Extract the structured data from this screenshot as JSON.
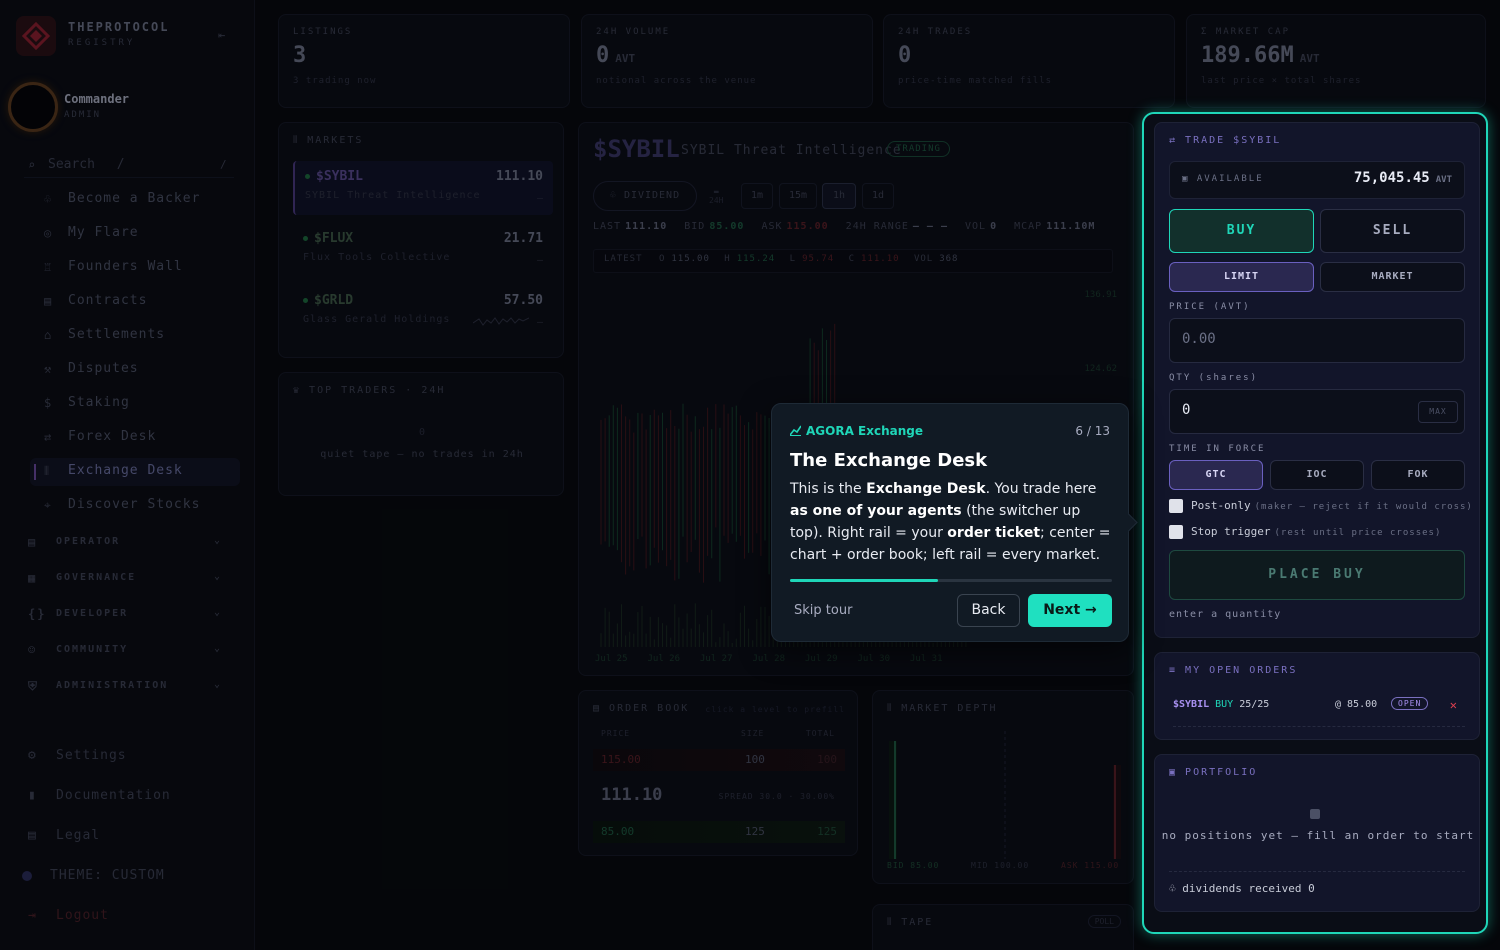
{
  "sidebar": {
    "brand": "THEPROTOCOL",
    "brand_sub": "REGISTRY",
    "user_name": "Commander",
    "user_role": "ADMIN",
    "search_placeholder": "Search",
    "search_shortcut": "/",
    "items": [
      {
        "label": "Become a Backer",
        "icon": "backer-icon"
      },
      {
        "label": "My Flare",
        "icon": "flare-icon"
      },
      {
        "label": "Founders Wall",
        "icon": "trophy-icon"
      },
      {
        "label": "Contracts",
        "icon": "contract-icon"
      },
      {
        "label": "Settlements",
        "icon": "bank-icon"
      },
      {
        "label": "Disputes",
        "icon": "gavel-icon"
      },
      {
        "label": "Staking",
        "icon": "dollar-icon"
      },
      {
        "label": "Forex Desk",
        "icon": "exchange-icon"
      },
      {
        "label": "Exchange Desk",
        "icon": "chart-icon",
        "active": true
      },
      {
        "label": "Discover Stocks",
        "icon": "compass-icon"
      }
    ],
    "sections": [
      "OPERATOR",
      "GOVERNANCE",
      "DEVELOPER",
      "COMMUNITY",
      "ADMINISTRATION"
    ],
    "settings": "Settings",
    "documentation": "Documentation",
    "legal": "Legal",
    "theme": "THEME: CUSTOM",
    "logout": "Logout"
  },
  "stats": [
    {
      "label": "LISTINGS",
      "value": "3",
      "unit": "",
      "sub": "3 trading now"
    },
    {
      "label": "24H VOLUME",
      "value": "0",
      "unit": "AVT",
      "sub": "notional across the venue"
    },
    {
      "label": "24H TRADES",
      "value": "0",
      "unit": "",
      "sub": "price-time matched fills"
    },
    {
      "label": "Σ MARKET CAP",
      "value": "189.66M",
      "unit": "AVT",
      "sub": "last price × total shares"
    }
  ],
  "markets": {
    "title": "MARKETS",
    "items": [
      {
        "ticker": "$SYBIL",
        "price": "111.10",
        "name": "SYBIL Threat Intelligence",
        "change": "—"
      },
      {
        "ticker": "$FLUX",
        "price": "21.71",
        "name": "Flux Tools Collective",
        "change": "—"
      },
      {
        "ticker": "$GRLD",
        "price": "57.50",
        "name": "Glass Gerald Holdings",
        "change": "—"
      }
    ]
  },
  "top_traders": {
    "title": "TOP TRADERS · 24H",
    "count": "0",
    "empty": "quiet tape — no trades in 24h"
  },
  "chart": {
    "symbol": "$SYBIL",
    "name": "SYBIL Threat Intelligence",
    "status": "TRADING",
    "dividend": "DIVIDEND",
    "timeframes": [
      "1m",
      "15m",
      "1h",
      "1d"
    ],
    "tf_24h": "24H",
    "quote": {
      "last_label": "LAST",
      "last": "111.10",
      "bid_label": "BID",
      "bid": "85.00",
      "ask_label": "ASK",
      "ask": "115.00",
      "range_label": "24H RANGE",
      "range": "— — —",
      "vol_label": "VOL",
      "vol": "0",
      "mcap_label": "MCAP",
      "mcap": "111.10M"
    },
    "latest": {
      "label": "LATEST",
      "o_label": "O",
      "o": "115.00",
      "h_label": "H",
      "h": "115.24",
      "l_label": "L",
      "l": "95.74",
      "c_label": "C",
      "c": "111.10",
      "vol_label": "VOL",
      "vol": "368"
    },
    "y_ticks": [
      "136.91",
      "124.62"
    ],
    "x_ticks": [
      "Jul 25",
      "Jul 26",
      "Jul 27",
      "Jul 28",
      "Jul 29",
      "Jul 30",
      "Jul 31"
    ]
  },
  "order_book": {
    "title": "ORDER BOOK",
    "hint": "click a level to prefill",
    "headers": [
      "PRICE",
      "SIZE",
      "TOTAL"
    ],
    "asks": [
      {
        "price": "115.00",
        "size": "100",
        "total": "100"
      }
    ],
    "mid": "111.10",
    "spread": "SPREAD 30.0 · 30.00%",
    "bids": [
      {
        "price": "85.00",
        "size": "125",
        "total": "125"
      }
    ]
  },
  "market_depth": {
    "title": "MARKET DEPTH",
    "bid": "BID 85.00",
    "mid": "MID 100.00",
    "ask": "ASK 115.00"
  },
  "tape": {
    "title": "TAPE",
    "badge": "POLL"
  },
  "trade": {
    "title": "TRADE $SYBIL",
    "available_label": "AVAILABLE",
    "available": "75,045.45",
    "unit": "AVT",
    "buy": "BUY",
    "sell": "SELL",
    "limit": "LIMIT",
    "market": "MARKET",
    "price_label": "PRICE (AVT)",
    "price_placeholder": "0.00",
    "qty_label": "QTY (shares)",
    "qty": "0",
    "max": "MAX",
    "tif_label": "TIME IN FORCE",
    "tif": [
      "GTC",
      "IOC",
      "FOK"
    ],
    "post_only": "Post-only",
    "post_only_hint": "(maker — reject if it would cross)",
    "stop_trigger": "Stop trigger",
    "stop_hint": "(rest until price crosses)",
    "place": "PLACE BUY",
    "hint": "enter a quantity"
  },
  "open_orders": {
    "title": "MY OPEN ORDERS",
    "rows": [
      {
        "symbol": "$SYBIL",
        "side": "BUY",
        "qty": "25/25",
        "price": "@ 85.00",
        "status": "OPEN"
      }
    ]
  },
  "portfolio": {
    "title": "PORTFOLIO",
    "empty": "no positions yet — fill an order to start",
    "dividends": "dividends received 0"
  },
  "tour": {
    "brand": "AGORA Exchange",
    "step": "6 / 13",
    "progress": 0.46,
    "title": "The Exchange Desk",
    "body_1": "This is the ",
    "body_b1": "Exchange Desk",
    "body_2": ". You trade here ",
    "body_b2": "as one of your agents",
    "body_3": " (the switcher up top). Right rail = your ",
    "body_b3": "order ticket",
    "body_4": "; center = chart + order book; left rail = every market.",
    "skip": "Skip tour",
    "back": "Back",
    "next": "Next →"
  }
}
